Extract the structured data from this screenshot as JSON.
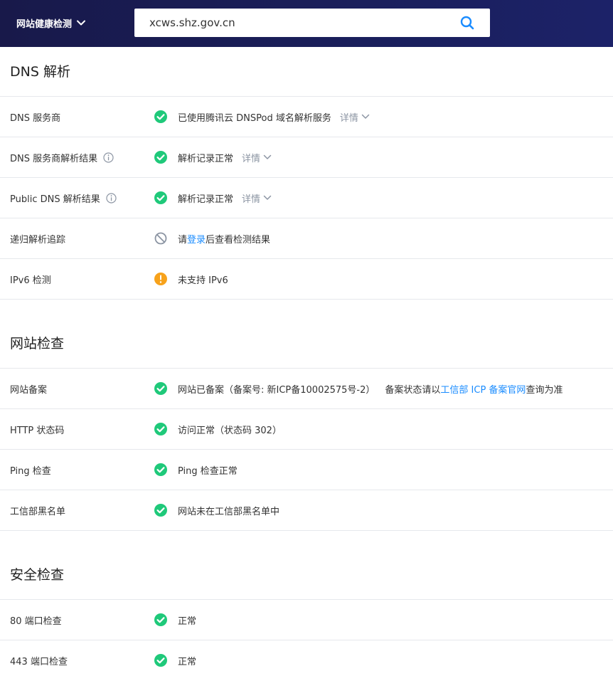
{
  "header": {
    "brand": "网站健康检测",
    "search_value": "xcws.shz.gov.cn"
  },
  "colors": {
    "ok": "#1fc97a",
    "warn": "#f7a21b",
    "disabled": "#8c95a3",
    "link": "#1a8cff"
  },
  "dns": {
    "title": "DNS 解析",
    "rows": [
      {
        "label": "DNS 服务商",
        "status": "ok",
        "value": "已使用腾讯云 DNSPod 域名解析服务",
        "detail": "详情"
      },
      {
        "label": "DNS 服务商解析结果",
        "status": "ok",
        "value": "解析记录正常",
        "detail": "详情"
      },
      {
        "label": "Public DNS 解析结果",
        "status": "ok",
        "value": "解析记录正常",
        "detail": "详情"
      },
      {
        "label": "递归解析追踪",
        "status": "disabled",
        "value_pre": "请",
        "value_link": "登录",
        "value_post": "后查看检测结果"
      },
      {
        "label": "IPv6 检测",
        "status": "warn",
        "value": "未支持 IPv6"
      }
    ]
  },
  "site": {
    "title": "网站检查",
    "rows": [
      {
        "label": "网站备案",
        "status": "ok",
        "value": "网站已备案（备案号: 新ICP备10002575号-2）",
        "value_note_pre": "备案状态请以",
        "value_link": "工信部 ICP 备案官网",
        "value_note_post": " 查询为准"
      },
      {
        "label": "HTTP 状态码",
        "status": "ok",
        "value": "访问正常（状态码 302）"
      },
      {
        "label": "Ping 检查",
        "status": "ok",
        "value": "Ping 检查正常"
      },
      {
        "label": "工信部黑名单",
        "status": "ok",
        "value": "网站未在工信部黑名单中"
      }
    ]
  },
  "security": {
    "title": "安全检查",
    "rows": [
      {
        "label": "80 端口检查",
        "status": "ok",
        "value": "正常"
      },
      {
        "label": "443 端口检查",
        "status": "ok",
        "value": "正常"
      }
    ]
  }
}
